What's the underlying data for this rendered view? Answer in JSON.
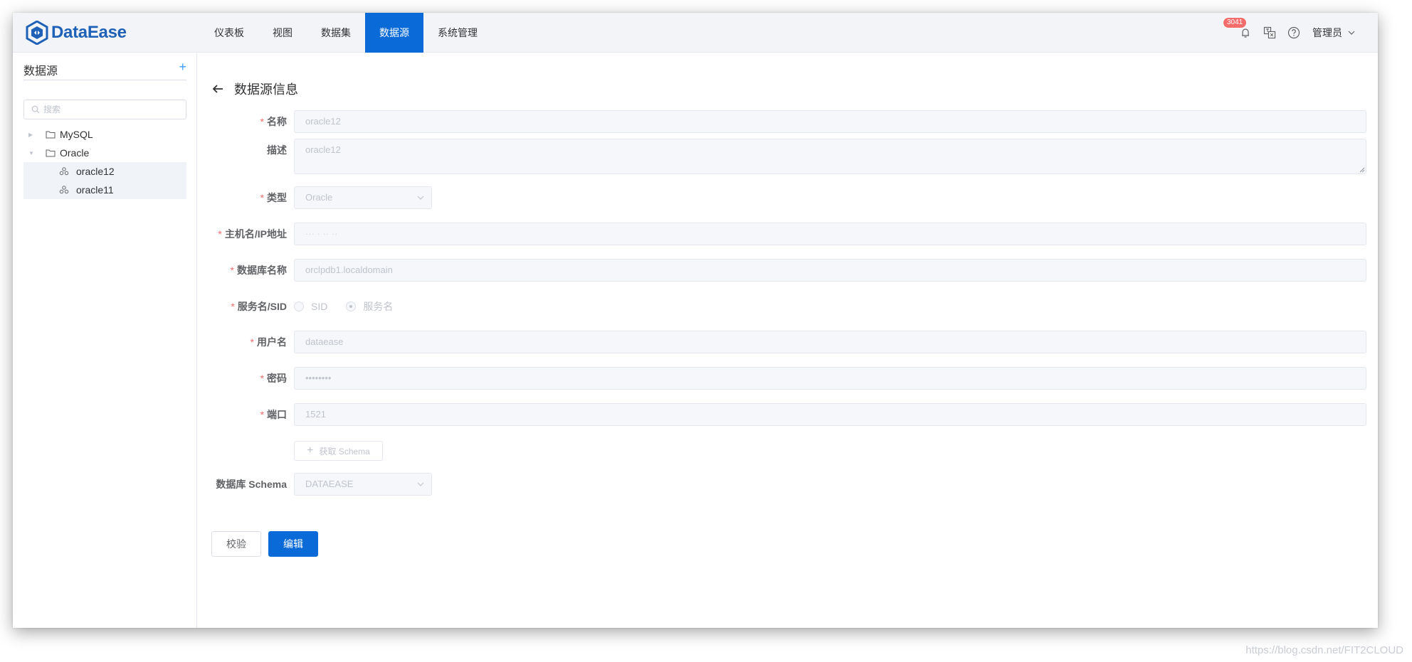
{
  "app": {
    "logo_text": "DataEase"
  },
  "nav": {
    "items": [
      {
        "label": "仪表板",
        "active": false
      },
      {
        "label": "视图",
        "active": false
      },
      {
        "label": "数据集",
        "active": false
      },
      {
        "label": "数据源",
        "active": true
      },
      {
        "label": "系统管理",
        "active": false
      }
    ]
  },
  "header": {
    "notification_count": "3041",
    "user_name": "管理员",
    "icons": [
      "bell-icon",
      "translate-icon",
      "help-icon",
      "chevron-down-icon"
    ]
  },
  "sidebar": {
    "title": "数据源",
    "add_label": "+",
    "search_placeholder": "搜索",
    "tree": [
      {
        "label": "MySQL",
        "expanded": false
      },
      {
        "label": "Oracle",
        "expanded": true,
        "children": [
          "oracle12",
          "oracle11"
        ]
      }
    ]
  },
  "form": {
    "title": "数据源信息",
    "fields": {
      "name": {
        "label": "名称",
        "value": "oracle12"
      },
      "desc": {
        "label": "描述",
        "value": "oracle12"
      },
      "type": {
        "label": "类型",
        "value": "Oracle"
      },
      "host": {
        "label": "主机名/IP地址",
        "value": "··· ·  ··           ··"
      },
      "dbname": {
        "label": "数据库名称",
        "value": "orclpdb1.localdomain"
      },
      "service": {
        "label": "服务名/SID",
        "options": [
          "SID",
          "服务名"
        ],
        "selected": "服务名"
      },
      "username": {
        "label": "用户名",
        "value": "dataease"
      },
      "password": {
        "label": "密码",
        "value": "••••••••"
      },
      "port": {
        "label": "端口",
        "value": "1521"
      },
      "schema": {
        "label": "数据库 Schema",
        "value": "DATAEASE"
      }
    },
    "get_schema_label": "获取 Schema",
    "validate_label": "校验",
    "edit_label": "编辑"
  },
  "watermark": "https://blog.csdn.net/FIT2CLOUD",
  "colors": {
    "primary": "#0a6bd8",
    "logo": "#1e61b6",
    "required": "#f56c6c",
    "badge": "#f56c6c"
  }
}
